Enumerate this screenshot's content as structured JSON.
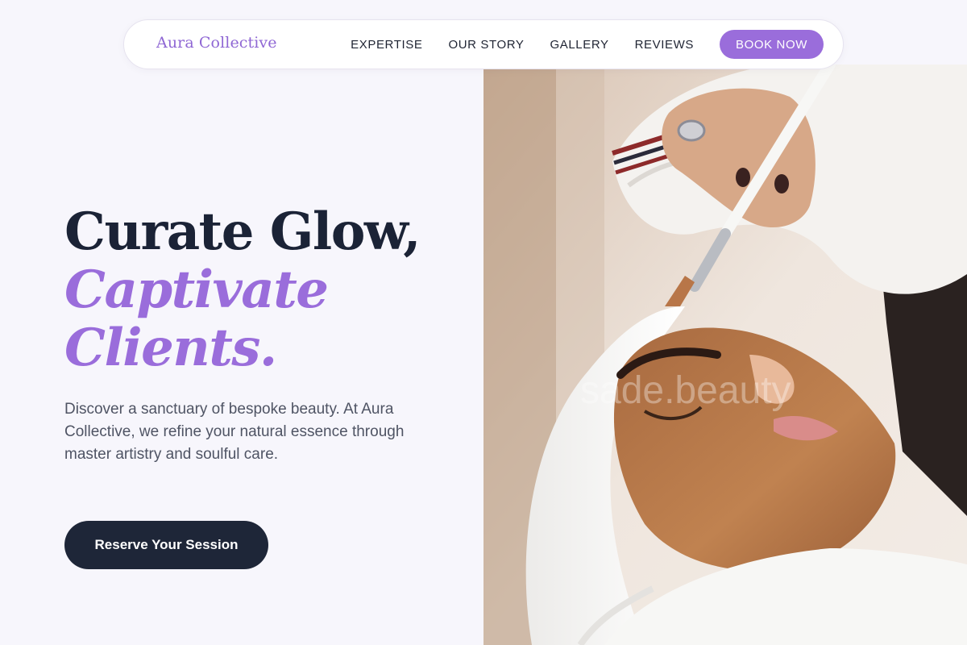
{
  "nav": {
    "brand": "Aura Collective",
    "links": [
      "EXPERTISE",
      "OUR STORY",
      "GALLERY",
      "REVIEWS"
    ],
    "book_label": "BOOK NOW"
  },
  "hero": {
    "headline_line1": "Curate Glow,",
    "headline_line2": "Captivate Clients.",
    "description": "Discover a sanctuary of bespoke beauty. At Aura Collective, we refine your natural essence through master artistry and soulful care.",
    "cta_label": "Reserve Your Session",
    "image_watermark": "sade.beauty"
  },
  "colors": {
    "accent": "#9a6ddb",
    "dark": "#1e2638",
    "background": "#f7f6fc"
  }
}
